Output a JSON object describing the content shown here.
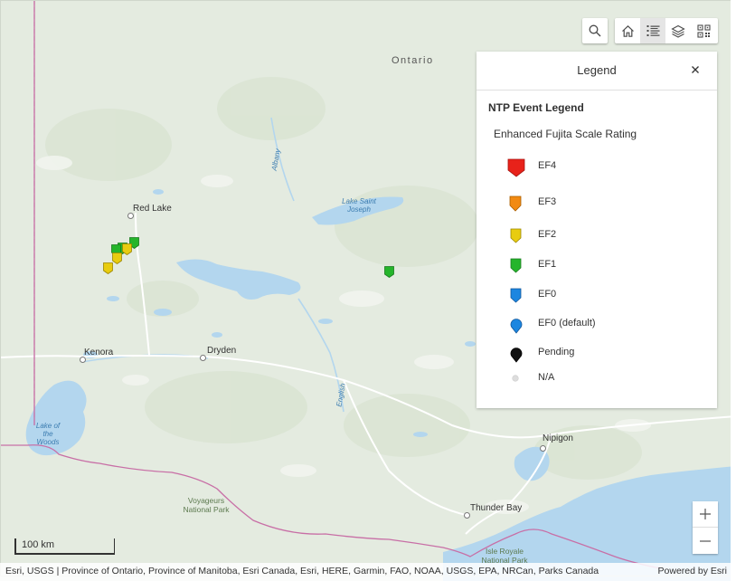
{
  "map": {
    "places": [
      {
        "id": "ontario",
        "text": "Ontario"
      },
      {
        "id": "red-lake",
        "text": "Red Lake"
      },
      {
        "id": "kenora",
        "text": "Kenora"
      },
      {
        "id": "dryden",
        "text": "Dryden"
      },
      {
        "id": "nipigon",
        "text": "Nipigon"
      },
      {
        "id": "thunder-bay",
        "text": "Thunder Bay"
      }
    ],
    "water_labels": [
      {
        "id": "albany",
        "text": "Albany"
      },
      {
        "id": "lake-st-joseph",
        "text": "Lake Saint Joseph"
      },
      {
        "id": "english",
        "text": "English"
      },
      {
        "id": "lake-of-woods",
        "text": "Lake of the Woods"
      }
    ],
    "park_labels": [
      {
        "id": "voyageurs",
        "text": "Voyageurs National Park"
      },
      {
        "id": "isle-royale",
        "text": "Isle Royale National Park"
      }
    ],
    "markers": [
      {
        "rating": "EF1"
      },
      {
        "rating": "EF1"
      },
      {
        "rating": "EF1"
      },
      {
        "rating": "EF2"
      },
      {
        "rating": "EF2"
      },
      {
        "rating": "EF2"
      },
      {
        "rating": "EF1"
      }
    ]
  },
  "toolbar": {
    "search": "search-icon",
    "home": "home-icon",
    "legend": "legend-list-icon",
    "layers": "layers-icon",
    "basemap": "basemap-gallery-icon"
  },
  "legend": {
    "title": "Legend",
    "layer_title": "NTP Event Legend",
    "field_title": "Enhanced Fujita Scale Rating",
    "items": [
      {
        "label": "EF4",
        "color": "#e8221a",
        "shape": "pin-large"
      },
      {
        "label": "EF3",
        "color": "#f28a12",
        "shape": "pin"
      },
      {
        "label": "EF2",
        "color": "#e8cc10",
        "shape": "pin"
      },
      {
        "label": "EF1",
        "color": "#25b52b",
        "shape": "pin"
      },
      {
        "label": "EF0",
        "color": "#1c86e0",
        "shape": "pin"
      },
      {
        "label": "EF0 (default)",
        "color": "#1c86e0",
        "shape": "drop"
      },
      {
        "label": "Pending",
        "color": "#111111",
        "shape": "drop"
      },
      {
        "label": "N/A",
        "color": "#dddddd",
        "shape": "dot"
      }
    ]
  },
  "zoom": {
    "in": "+",
    "out": "—"
  },
  "scale": {
    "label": "100 km"
  },
  "attribution": {
    "sources": "Esri, USGS | Province of Ontario, Province of Manitoba, Esri Canada, Esri, HERE, Garmin, FAO, NOAA, USGS, EPA, NRCan, Parks Canada",
    "powered": "Powered by Esri"
  },
  "colors": {
    "land": "#e4ebe0",
    "forest": "#dde7d6",
    "water": "#b3d6ee",
    "boundary": "#c86fa6",
    "road": "#ffffff"
  }
}
